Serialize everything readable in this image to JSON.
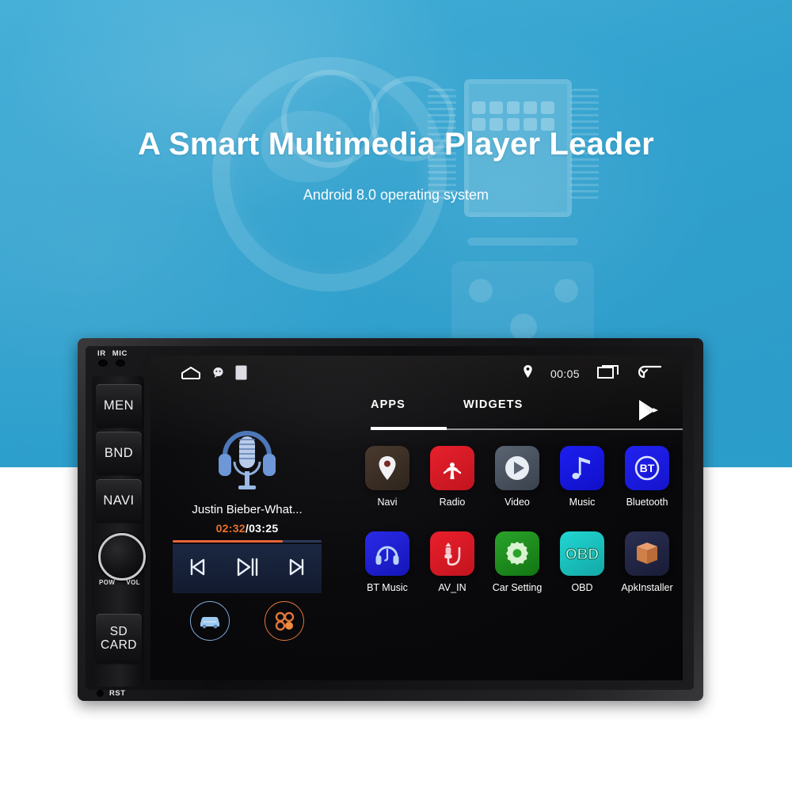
{
  "hero": {
    "title": "A Smart Multimedia Player Leader",
    "subtitle": "Android 8.0 operating system",
    "background_color": "#2c9fcd",
    "background_image": "car-dashboard-photo"
  },
  "device": {
    "front_panel": {
      "ir_label": "IR",
      "mic_label": "MIC",
      "reset_label": "RST",
      "buttons": [
        {
          "label": "MEN",
          "name": "menu-button"
        },
        {
          "label": "BND",
          "name": "band-button"
        },
        {
          "label": "NAVI",
          "name": "navi-button"
        }
      ],
      "knob": {
        "left_label": "POW",
        "right_label": "VOL"
      },
      "sd_card": {
        "line1": "SD",
        "line2": "CARD"
      }
    },
    "screen": {
      "statusbar": {
        "home_icon": "home-icon",
        "waze_icon": "waze-icon",
        "card_icon": "card-icon",
        "location_icon": "location-pin-icon",
        "time": "00:05",
        "recents_icon": "recents-icon",
        "back_icon": "back-arrow-icon"
      },
      "tabs": [
        {
          "label": "APPS",
          "active": true
        },
        {
          "label": "WIDGETS",
          "active": false
        }
      ],
      "play_store_icon": "google-play-icon",
      "apps": [
        [
          {
            "label": "Navi",
            "icon": "location-pin-icon",
            "color": "#3d3026"
          },
          {
            "label": "Radio",
            "icon": "radio-waves-icon",
            "color": "#e8202c"
          },
          {
            "label": "Video",
            "icon": "play-circle-icon",
            "color": "#5a6472"
          },
          {
            "label": "Music",
            "icon": "music-note-icon",
            "color": "#1d1ef0"
          },
          {
            "label": "Bluetooth",
            "icon": "bt-icon",
            "color": "#2222f2"
          }
        ],
        [
          {
            "label": "BT Music",
            "icon": "headphones-icon",
            "color": "#2a2ae8"
          },
          {
            "label": "AV_IN",
            "icon": "av-plug-icon",
            "color": "#ea1f2c"
          },
          {
            "label": "Car Setting",
            "icon": "gear-icon",
            "color": "#2aa32a"
          },
          {
            "label": "OBD",
            "icon": "obd-icon",
            "color": "#21d6d2",
            "text": "OBD"
          },
          {
            "label": "ApkInstaller",
            "icon": "box-icon",
            "color": "#2b2f52"
          }
        ]
      ],
      "player": {
        "album_art": "microphone-headphones-icon",
        "track_title": "Justin Bieber-What...",
        "current_time": "02:32",
        "separator": "/",
        "total_time": "03:25",
        "progress_percent": 74,
        "progress_color": "#e8653a",
        "controls": [
          {
            "name": "previous-track-button",
            "icon": "skip-previous-icon"
          },
          {
            "name": "play-pause-button",
            "icon": "play-pause-icon"
          },
          {
            "name": "next-track-button",
            "icon": "skip-next-icon"
          }
        ],
        "shortcuts": [
          {
            "name": "car-shortcut-button",
            "icon": "car-icon",
            "color": "#7fa8d8"
          },
          {
            "name": "apps-shortcut-button",
            "icon": "four-dots-icon",
            "color": "#e2763a"
          }
        ]
      }
    }
  }
}
